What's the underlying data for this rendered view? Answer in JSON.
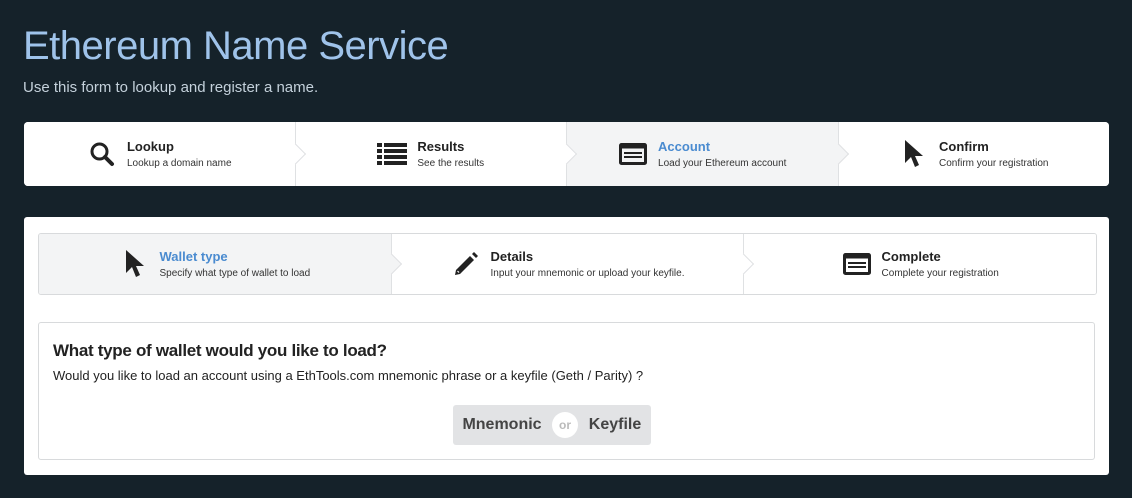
{
  "header": {
    "title": "Ethereum Name Service",
    "subtitle": "Use this form to lookup and register a name."
  },
  "steps": [
    {
      "label": "Lookup",
      "desc": "Lookup a domain name",
      "icon": "search-icon",
      "active": false
    },
    {
      "label": "Results",
      "desc": "See the results",
      "icon": "list-icon",
      "active": false
    },
    {
      "label": "Account",
      "desc": "Load your Ethereum account",
      "icon": "card-icon",
      "active": true
    },
    {
      "label": "Confirm",
      "desc": "Confirm your registration",
      "icon": "pointer-icon",
      "active": false
    }
  ],
  "substeps": [
    {
      "label": "Wallet type",
      "desc": "Specify what type of wallet to load",
      "icon": "pointer-icon",
      "active": true
    },
    {
      "label": "Details",
      "desc": "Input your mnemonic or upload your keyfile.",
      "icon": "pencil-icon",
      "active": false
    },
    {
      "label": "Complete",
      "desc": "Complete your registration",
      "icon": "card-icon",
      "active": false
    }
  ],
  "wallet": {
    "question": "What type of wallet would you like to load?",
    "description": "Would you like to load an account using a EthTools.com mnemonic phrase or a keyfile (Geth / Parity) ?",
    "mnemonic_label": "Mnemonic",
    "or_label": "or",
    "keyfile_label": "Keyfile"
  },
  "colors": {
    "background": "#15222a",
    "title": "#9fc3ea",
    "active_label": "#4a8bd0"
  }
}
